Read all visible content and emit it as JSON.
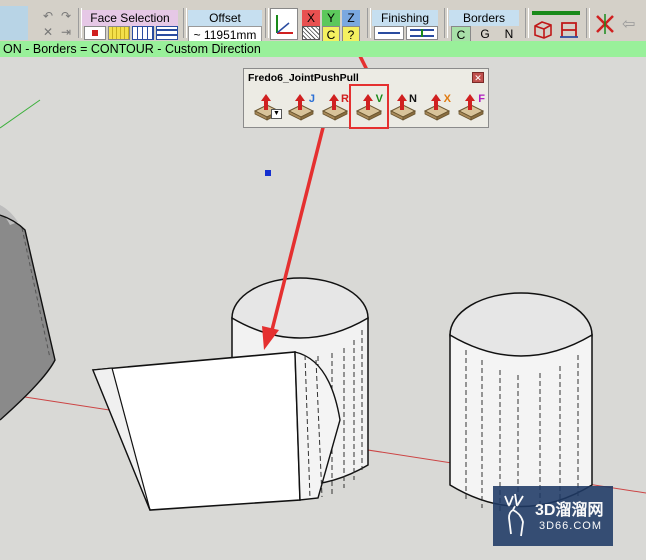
{
  "toolbar": {
    "face_selection_label": "Face Selection",
    "offset_label": "Offset",
    "offset_value": "~ 11951mm",
    "axis_x": "X",
    "axis_y": "Y",
    "axis_z": "Z",
    "axis_c": "C",
    "axis_q": "?",
    "finishing_label": "Finishing",
    "borders_label": "Borders",
    "borders_c": "C",
    "borders_g": "G",
    "borders_n": "N"
  },
  "status_text": "ON - Borders = CONTOUR - Custom Direction",
  "plugin": {
    "title": "Fredo6_JointPushPull",
    "buttons": [
      {
        "letter": "",
        "name": "joint-pushpull-dropdown"
      },
      {
        "letter": "J",
        "color": "#2a6fd6"
      },
      {
        "letter": "R",
        "color": "#d02020"
      },
      {
        "letter": "V",
        "color": "#1a8a1a"
      },
      {
        "letter": "N",
        "color": "#111111"
      },
      {
        "letter": "X",
        "color": "#e07a10"
      },
      {
        "letter": "F",
        "color": "#b020c0"
      }
    ]
  },
  "watermark": {
    "title": "3D溜溜网",
    "subtitle": "3D66.COM"
  },
  "colors": {
    "status_bg": "#99f09a",
    "highlight": "#e53030",
    "arrow": "#e53030"
  }
}
